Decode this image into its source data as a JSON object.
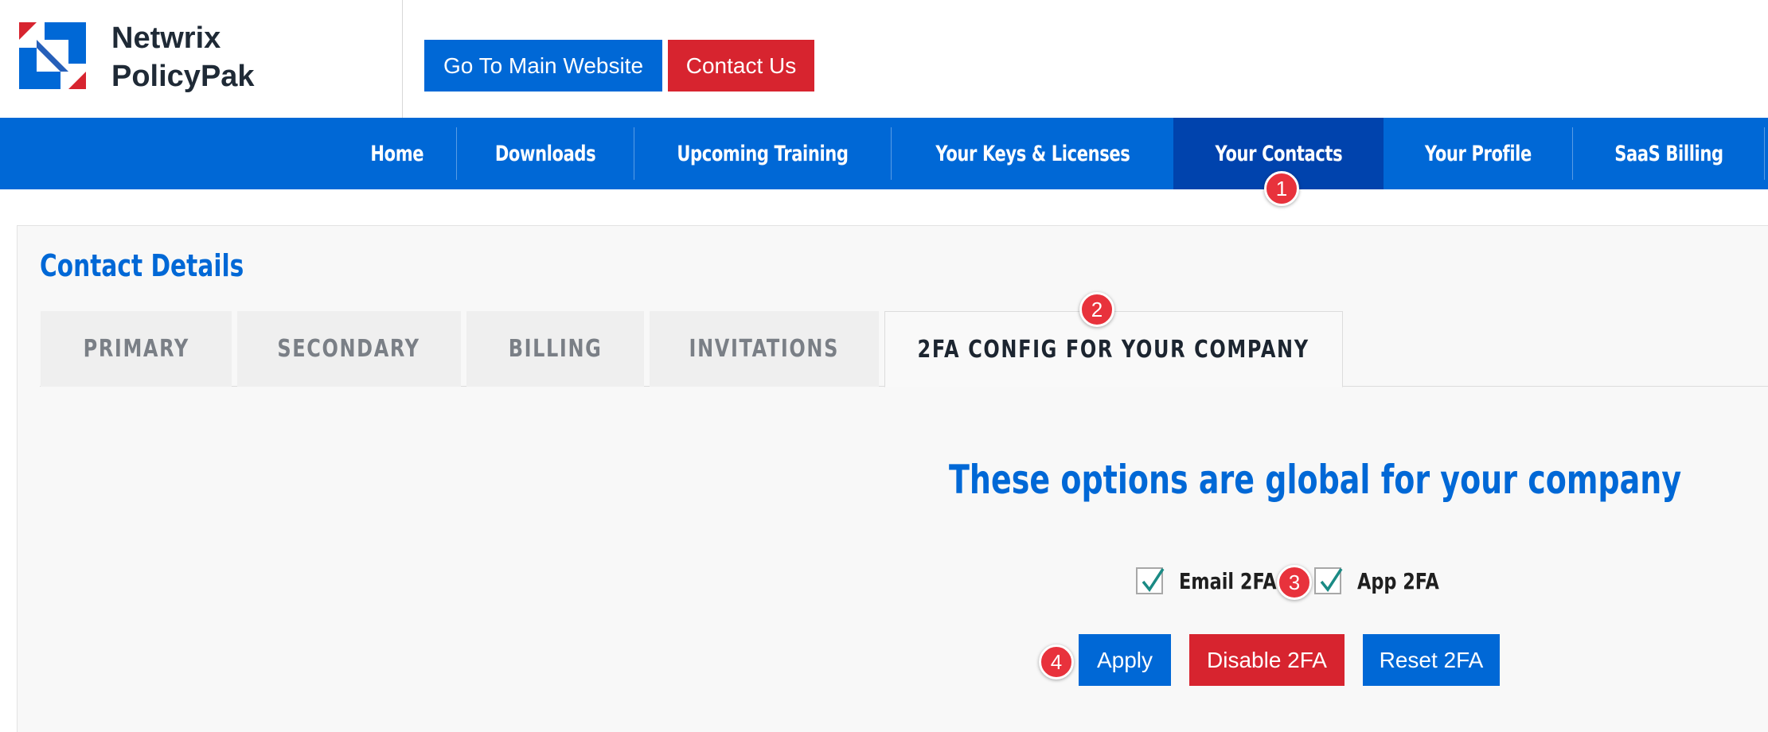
{
  "brand": {
    "line1": "Netwrix",
    "line2": "PolicyPak"
  },
  "header_buttons": {
    "main_website": "Go To Main Website",
    "contact_us": "Contact Us"
  },
  "nav": {
    "items": [
      {
        "label": "Home"
      },
      {
        "label": "Downloads"
      },
      {
        "label": "Upcoming Training"
      },
      {
        "label": "Your Keys & Licenses"
      },
      {
        "label": "Your Contacts",
        "active": true
      },
      {
        "label": "Your Profile"
      },
      {
        "label": "SaaS Billing"
      }
    ]
  },
  "page": {
    "title": "Contact Details"
  },
  "tabs": [
    {
      "label": "PRIMARY"
    },
    {
      "label": "SECONDARY"
    },
    {
      "label": "BILLING"
    },
    {
      "label": "INVITATIONS"
    },
    {
      "label": "2FA CONFIG FOR YOUR COMPANY",
      "active": true
    }
  ],
  "twofa": {
    "heading": "These options are global for your company",
    "options": [
      {
        "label": "Email 2FA",
        "checked": true
      },
      {
        "label": "App 2FA",
        "checked": true
      }
    ],
    "buttons": {
      "apply": "Apply",
      "disable": "Disable 2FA",
      "reset": "Reset 2FA"
    }
  },
  "badges": [
    "1",
    "2",
    "3",
    "4"
  ],
  "colors": {
    "primary_blue": "#0068d6",
    "active_nav": "#0043ad",
    "red": "#d7242f",
    "badge_red": "#e8323c",
    "check_teal": "#1a8a84"
  }
}
